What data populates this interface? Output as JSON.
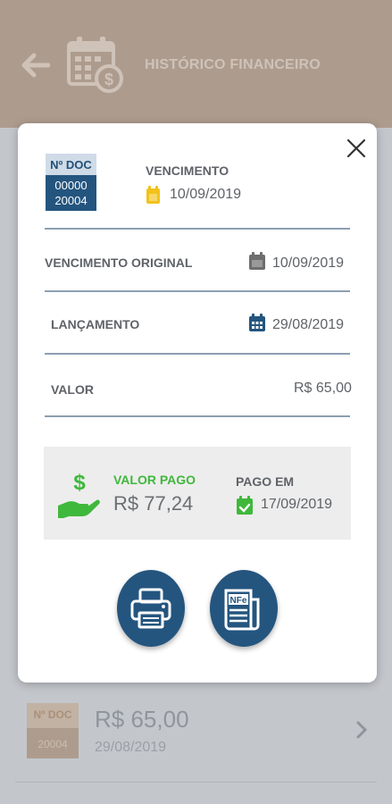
{
  "header": {
    "title": "HISTÓRICO FINANCEIRO",
    "icon": "calendar-money-icon"
  },
  "background_item": {
    "doc_label": "Nº DOC",
    "doc_number": "20004",
    "amount": "R$ 65,00",
    "date": "29/08/2019"
  },
  "modal": {
    "doc_label": "Nº DOC",
    "doc_number_line1": "00000",
    "doc_number_line2": "20004",
    "vencimento_label": "VENCIMENTO",
    "vencimento_date": "10/09/2019",
    "rows": [
      {
        "label": "VENCIMENTO ORIGINAL",
        "value": "10/09/2019"
      },
      {
        "label": "LANÇAMENTO",
        "value": "29/08/2019"
      },
      {
        "label": "VALOR",
        "value": "R$ 65,00"
      }
    ],
    "paid": {
      "label": "VALOR PAGO",
      "amount": "R$ 77,24",
      "paid_on_label": "PAGO EM",
      "paid_on_date": "17/09/2019"
    },
    "buttons": [
      {
        "icon": "printer-icon"
      },
      {
        "icon": "nfe-document-icon",
        "text": "NFe"
      }
    ]
  },
  "colors": {
    "primary": "#24557f",
    "green": "#3fb83c",
    "yellow": "#f2c21b",
    "header": "#ad9c8e"
  }
}
